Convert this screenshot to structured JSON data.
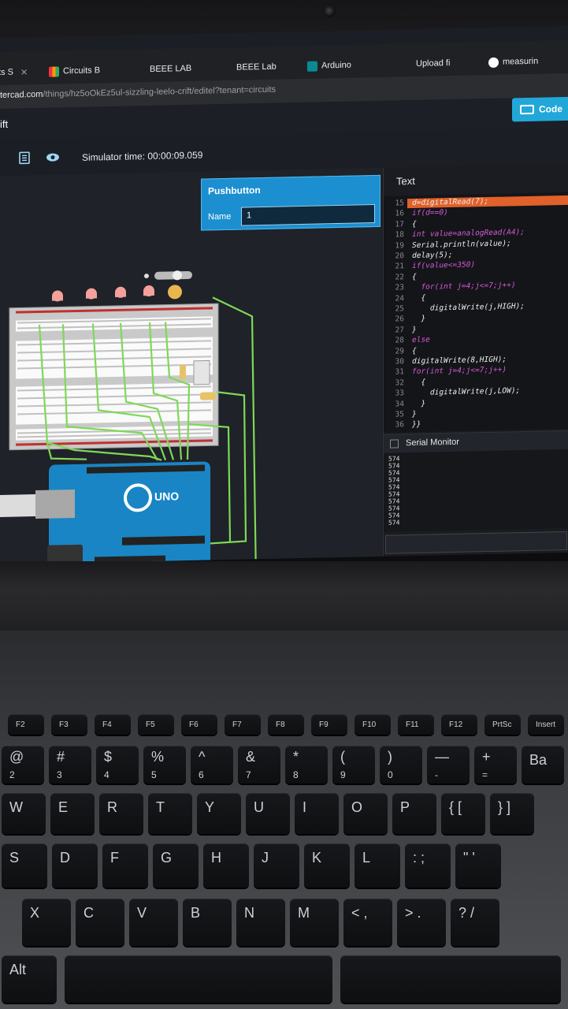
{
  "browser": {
    "tabs": [
      {
        "label": "ts S",
        "icon": "tinkercad-icon"
      },
      {
        "label": "Circuits B",
        "icon": "circuits-icon"
      },
      {
        "label": "BEEE LAB",
        "icon": ""
      },
      {
        "label": "BEEE Lab",
        "icon": ""
      },
      {
        "label": "Arduino",
        "icon": "arduino-icon"
      },
      {
        "label": "Upload fi",
        "icon": ""
      },
      {
        "label": "measurin",
        "icon": "globe-icon"
      }
    ],
    "url_host": "tercad.com",
    "url_path": "/things/hz5oOkEz5ul-sizzling-leelo-crift/editel?tenant=circuits"
  },
  "tinkercad": {
    "title": "ift",
    "code_button": "Code",
    "simulator_time": "Simulator time: 00:00:09.059",
    "pushbutton_panel": {
      "title": "Pushbutton",
      "name_label": "Name",
      "name_value": "1"
    },
    "code_tab": "Text",
    "code_lines": [
      {
        "n": "15",
        "t": "d=digitalRead(7);",
        "hl": true
      },
      {
        "n": "16",
        "t": "if(d==0)"
      },
      {
        "n": "17",
        "t": "{"
      },
      {
        "n": "18",
        "t": "int value=analogRead(A4);"
      },
      {
        "n": "19",
        "t": "Serial.println(value);"
      },
      {
        "n": "20",
        "t": "delay(5);"
      },
      {
        "n": "21",
        "t": "if(value<=350)"
      },
      {
        "n": "22",
        "t": "{"
      },
      {
        "n": "23",
        "t": "  for(int j=4;j<=7;j++)"
      },
      {
        "n": "24",
        "t": "  {"
      },
      {
        "n": "25",
        "t": "    digitalWrite(j,HIGH);"
      },
      {
        "n": "26",
        "t": "  }"
      },
      {
        "n": "27",
        "t": "}"
      },
      {
        "n": "28",
        "t": "else"
      },
      {
        "n": "29",
        "t": "{"
      },
      {
        "n": "30",
        "t": "digitalWrite(8,HIGH);"
      },
      {
        "n": "31",
        "t": "for(int j=4;j<=7;j++)"
      },
      {
        "n": "32",
        "t": "  {"
      },
      {
        "n": "33",
        "t": "    digitalWrite(j,LOW);"
      },
      {
        "n": "34",
        "t": "  }"
      },
      {
        "n": "35",
        "t": "}"
      },
      {
        "n": "36",
        "t": "}}"
      }
    ],
    "serial_monitor_title": "Serial Monitor",
    "serial_values": [
      "574",
      "574",
      "574",
      "574",
      "574",
      "574",
      "574",
      "574",
      "574",
      "574"
    ],
    "board_label": "UNO"
  },
  "keyboard": {
    "fn_row": [
      "F2",
      "F3",
      "F4",
      "F5",
      "F6",
      "F7",
      "F8",
      "F9",
      "F10",
      "F11",
      "F12",
      "PrtSc",
      "Insert"
    ],
    "num_row": [
      {
        "top": "@",
        "bot": "2"
      },
      {
        "top": "#",
        "bot": "3"
      },
      {
        "top": "$",
        "bot": "4"
      },
      {
        "top": "%",
        "bot": "5"
      },
      {
        "top": "^",
        "bot": "6"
      },
      {
        "top": "&",
        "bot": "7"
      },
      {
        "top": "*",
        "bot": "8"
      },
      {
        "top": "(",
        "bot": "9"
      },
      {
        "top": ")",
        "bot": "0"
      },
      {
        "top": "—",
        "bot": "-"
      },
      {
        "top": "+",
        "bot": "="
      },
      {
        "top": "Ba",
        "bot": ""
      }
    ],
    "top_row": [
      "W",
      "E",
      "R",
      "T",
      "Y",
      "U",
      "I",
      "O",
      "P",
      "{ [",
      "} ]"
    ],
    "home_row": [
      "S",
      "D",
      "F",
      "G",
      "H",
      "J",
      "K",
      "L",
      ": ;",
      "\" '"
    ],
    "bottom_row": [
      "X",
      "C",
      "V",
      "B",
      "N",
      "M",
      "< ,",
      "> .",
      "? /"
    ],
    "alt_label": "Alt"
  },
  "colors": {
    "accent": "#22a7d9",
    "panel": "#1c8fd0",
    "highlight": "#e0612a",
    "wire": "#7ed957"
  }
}
